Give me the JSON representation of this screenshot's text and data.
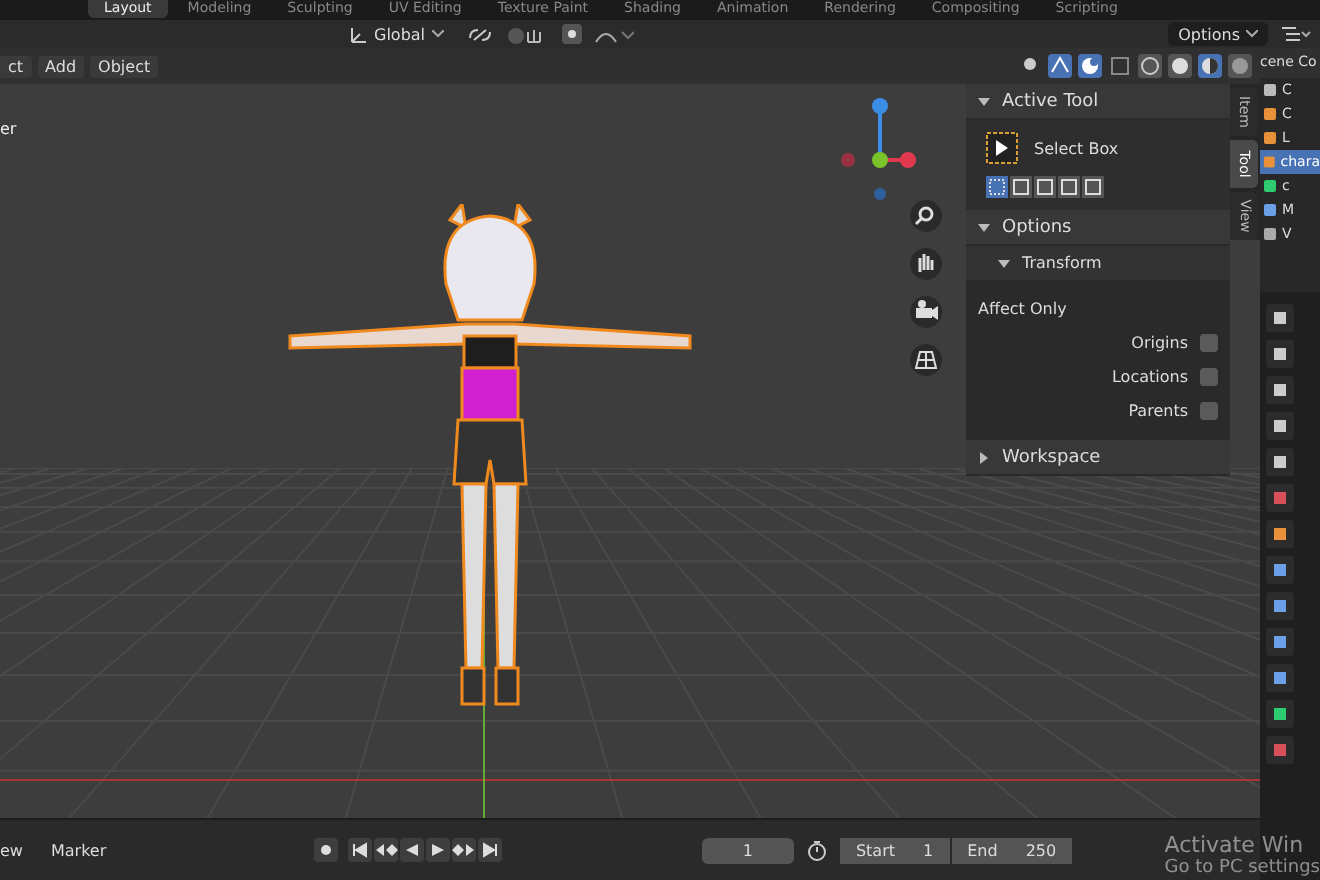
{
  "workspace_tabs": [
    {
      "label": "Layout",
      "selected": true
    },
    {
      "label": "Modeling",
      "selected": false
    },
    {
      "label": "Sculpting",
      "selected": false
    },
    {
      "label": "UV Editing",
      "selected": false
    },
    {
      "label": "Texture Paint",
      "selected": false
    },
    {
      "label": "Shading",
      "selected": false
    },
    {
      "label": "Animation",
      "selected": false
    },
    {
      "label": "Rendering",
      "selected": false
    },
    {
      "label": "Compositing",
      "selected": false
    },
    {
      "label": "Scripting",
      "selected": false
    }
  ],
  "header": {
    "orientation": "Global",
    "options": "Options"
  },
  "viewport_header": {
    "menus": [
      "ct",
      "Add",
      "Object"
    ]
  },
  "viewport": {
    "view_label": "er"
  },
  "sidebar": {
    "tabs": [
      {
        "label": "Item",
        "selected": false
      },
      {
        "label": "Tool",
        "selected": true
      },
      {
        "label": "View",
        "selected": false
      }
    ],
    "active_tool": {
      "title": "Active Tool",
      "expanded": true,
      "tool": "Select Box"
    },
    "options": {
      "title": "Options",
      "expanded": true,
      "transform": {
        "title": "Transform",
        "expanded": true
      },
      "affect_only": "Affect Only",
      "checkboxes": [
        {
          "label": "Origins",
          "checked": false
        },
        {
          "label": "Locations",
          "checked": false
        },
        {
          "label": "Parents",
          "checked": false
        }
      ]
    },
    "workspace": {
      "title": "Workspace",
      "expanded": false
    }
  },
  "outliner": {
    "title": "cene Co",
    "items": [
      {
        "label": "C",
        "selected": false
      },
      {
        "label": "C",
        "selected": false
      },
      {
        "label": "L",
        "selected": false
      },
      {
        "label": "chara",
        "selected": true
      },
      {
        "label": "c",
        "selected": false
      },
      {
        "label": "M",
        "selected": false
      },
      {
        "label": "V",
        "selected": false
      }
    ]
  },
  "timeline": {
    "menus": [
      "ew",
      "Marker"
    ],
    "current_frame": "1",
    "start_label": "Start",
    "start": "1",
    "end_label": "End",
    "end": "250"
  },
  "os_notice": {
    "title": "Activate Win",
    "subtitle": "Go to PC settings"
  }
}
